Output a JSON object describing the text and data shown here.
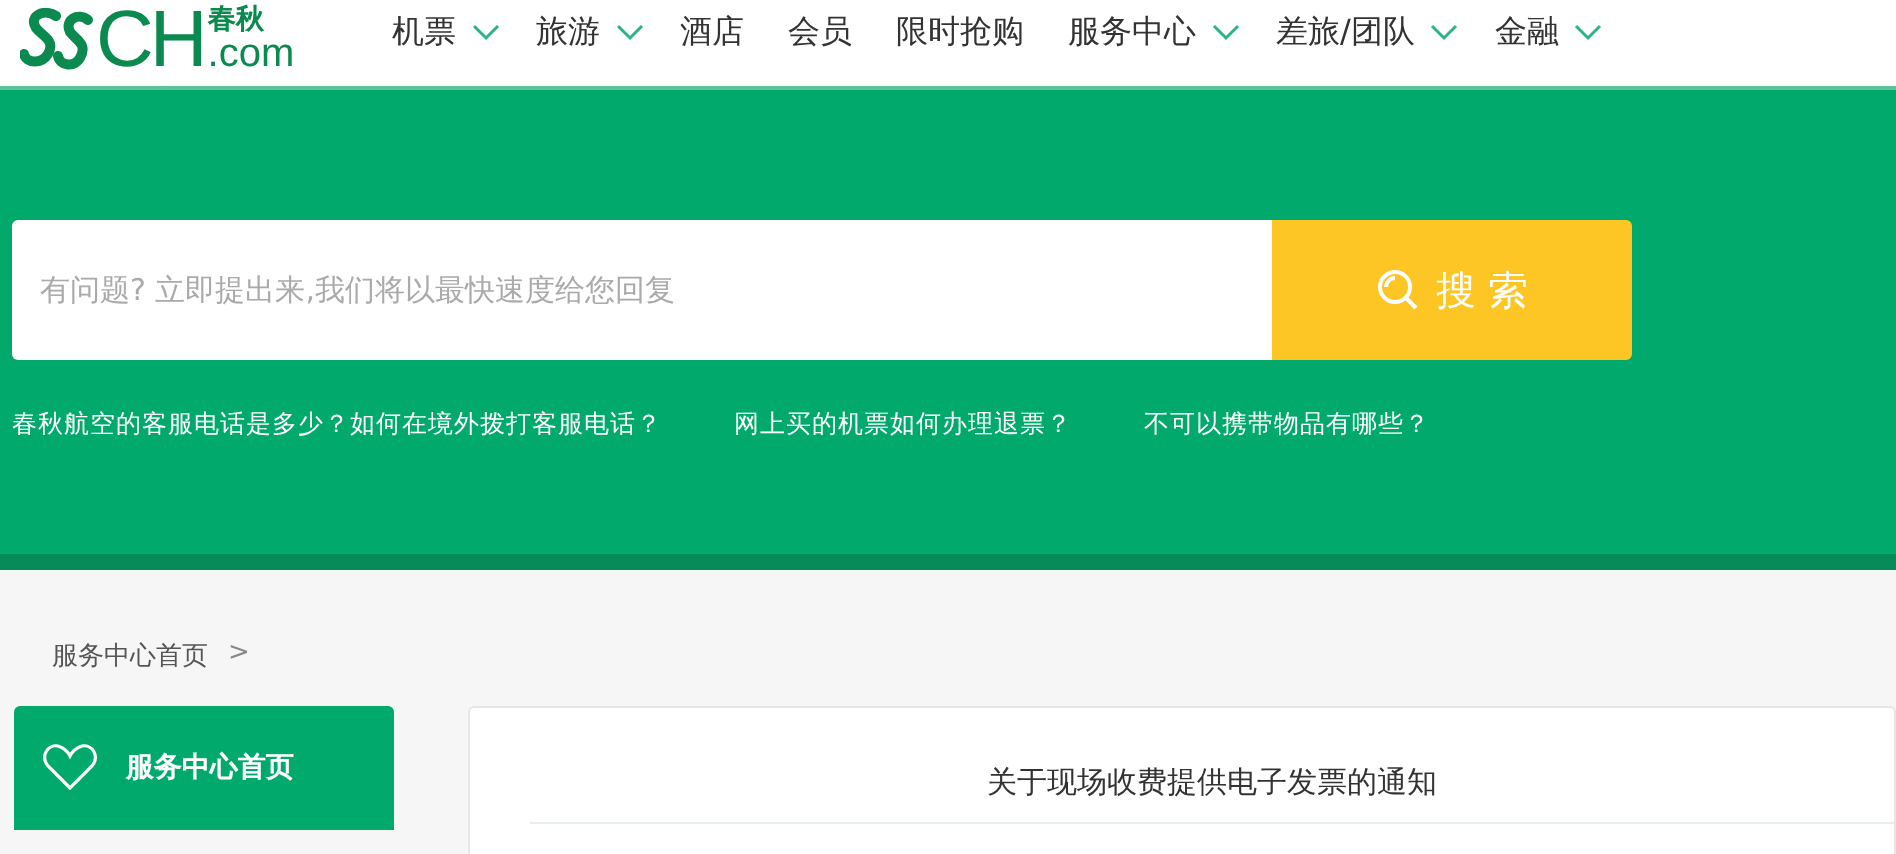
{
  "logo": {
    "letters": "CH",
    "cn_name": "春秋",
    "domain": ".com"
  },
  "nav": [
    {
      "label": "机票",
      "dropdown": true
    },
    {
      "label": "旅游",
      "dropdown": true
    },
    {
      "label": "酒店",
      "dropdown": false
    },
    {
      "label": "会员",
      "dropdown": false
    },
    {
      "label": "限时抢购",
      "dropdown": false
    },
    {
      "label": "服务中心",
      "dropdown": true
    },
    {
      "label": "差旅/团队",
      "dropdown": true
    },
    {
      "label": "金融",
      "dropdown": true
    }
  ],
  "search": {
    "placeholder": "有问题? 立即提出来,我们将以最快速度给您回复",
    "button": "搜 索"
  },
  "quick_links": [
    "春秋航空的客服电话是多少？如何在境外拨打客服电话？",
    "网上买的机票如何办理退票？",
    "不可以携带物品有哪些？"
  ],
  "breadcrumb": {
    "label": "服务中心首页",
    "separator": ">"
  },
  "sidebar": {
    "items": [
      {
        "label": "服务中心首页",
        "selected": true
      }
    ]
  },
  "content": {
    "title": "关于现场收费提供电子发票的通知"
  }
}
